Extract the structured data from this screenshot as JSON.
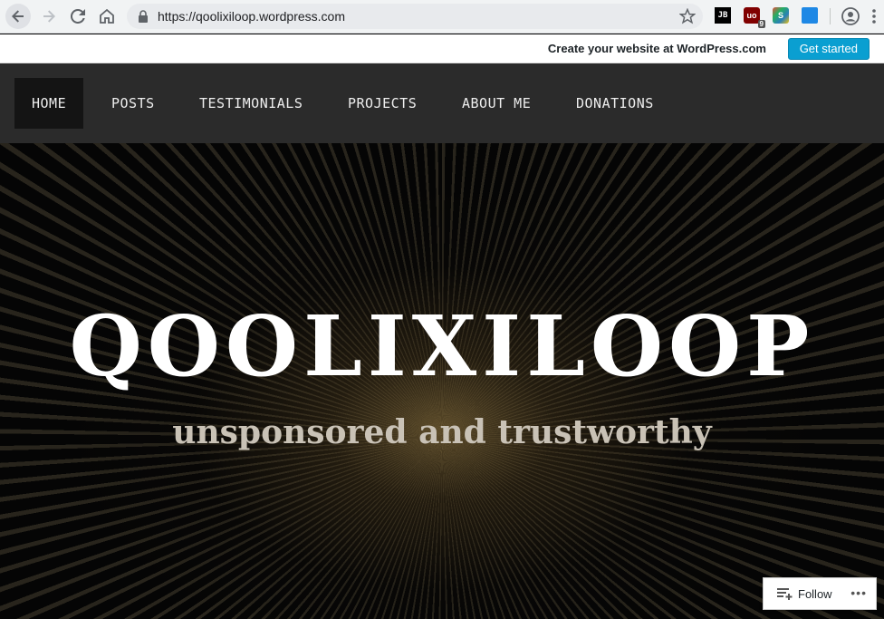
{
  "browser": {
    "url": "https://qoolixiloop.wordpress.com",
    "extensions": {
      "jb_label": "JB",
      "ublock_badge": "9"
    }
  },
  "wpbar": {
    "cta": "Create your website at WordPress.com",
    "button": "Get started"
  },
  "nav": {
    "items": [
      "HOME",
      "POSTS",
      "TESTIMONIALS",
      "PROJECTS",
      "ABOUT ME",
      "DONATIONS"
    ],
    "active": "HOME"
  },
  "hero": {
    "title": "QOOLIXILOOP",
    "tagline": "unsponsored and trustworthy"
  },
  "follow": {
    "label": "Follow",
    "more": "•••"
  },
  "colors": {
    "wp_button": "#0a9fd1",
    "nav_bg": "#2b2b2b",
    "nav_active": "#141414"
  }
}
